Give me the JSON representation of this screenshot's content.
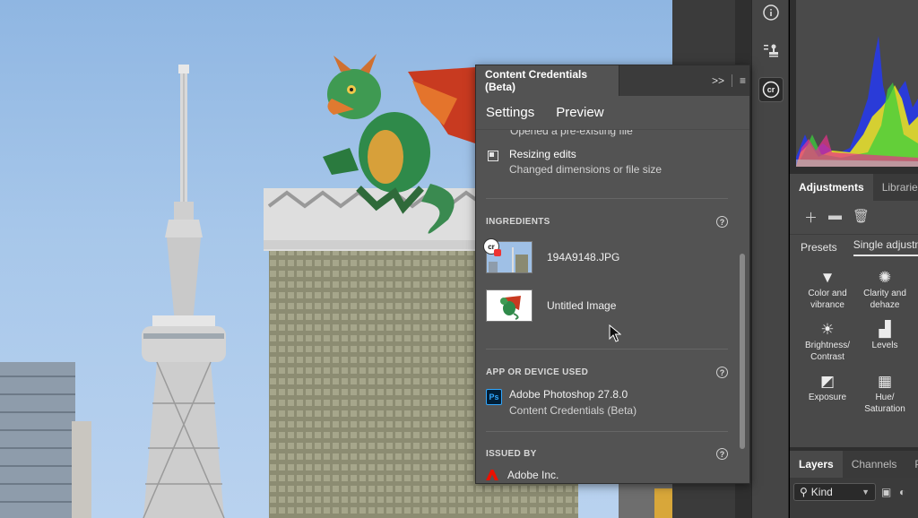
{
  "content_credentials": {
    "title": "Content Credentials (Beta)",
    "tabs": [
      "Settings",
      "Preview"
    ],
    "clipped_text": "Opened a pre-existing file",
    "history": {
      "title": "Resizing edits",
      "subtitle": "Changed dimensions or file size"
    },
    "ingredients": {
      "heading": "INGREDIENTS",
      "items": [
        {
          "name": "194A9148.JPG",
          "badge": "cr"
        },
        {
          "name": "Untitled Image"
        }
      ]
    },
    "app_used": {
      "heading": "APP OR DEVICE USED",
      "app_icon_label": "Ps",
      "app_name": "Adobe Photoshop 27.8.0",
      "app_detail": "Content Credentials (Beta)"
    },
    "issued_by": {
      "heading": "ISSUED BY",
      "issuer": "Adobe Inc."
    },
    "help_glyph": "?",
    "header_icons": [
      "double-chevron-right-icon",
      "menu-icon"
    ]
  },
  "icon_column": {
    "items": [
      "info-icon",
      "stamp-list-icon",
      "content-credentials-icon"
    ],
    "active_label": "cr"
  },
  "adjustments": {
    "tabs": [
      "Adjustments",
      "Libraries"
    ],
    "sub_tabs": [
      "Presets",
      "Single adjustm"
    ],
    "items": [
      {
        "label_1": "Color and",
        "label_2": "vibrance"
      },
      {
        "label_1": "Clarity and",
        "label_2": "dehaze"
      },
      {
        "label_1": "Brightness/",
        "label_2": "Contrast"
      },
      {
        "label_1": "Levels",
        "label_2": ""
      },
      {
        "label_1": "Exposure",
        "label_2": ""
      },
      {
        "label_1": "Hue/",
        "label_2": "Saturation"
      }
    ]
  },
  "layers": {
    "tabs": [
      "Layers",
      "Channels",
      "Pa"
    ],
    "filter_label": "Kind"
  },
  "colors": {
    "panel_bg": "#535353",
    "header_bg": "#3b3b3b",
    "ps_blue": "#31a8ff",
    "adobe_red": "#eb1000"
  }
}
